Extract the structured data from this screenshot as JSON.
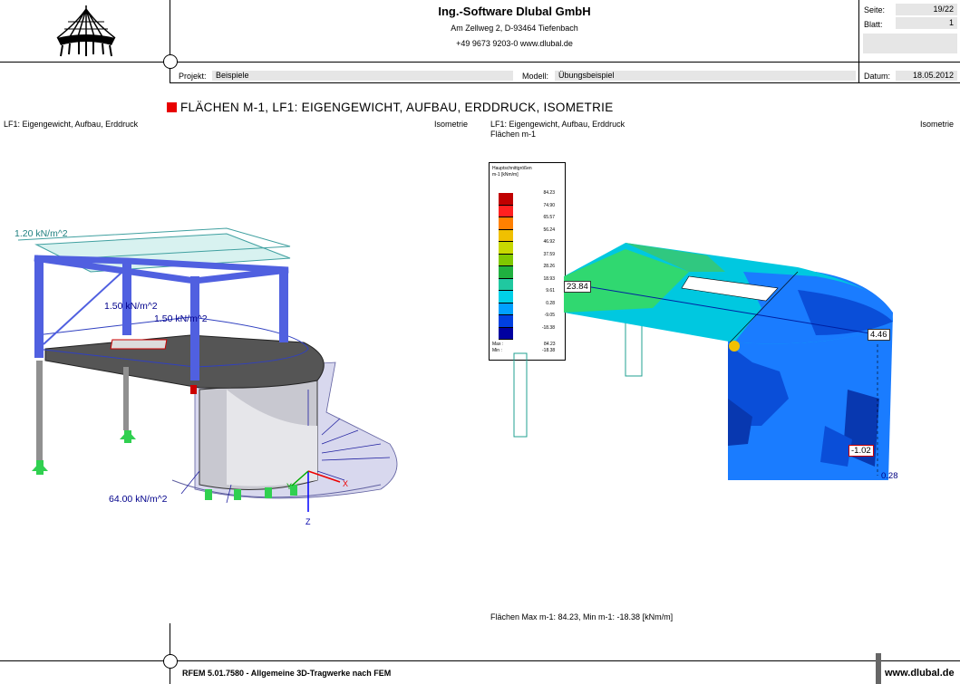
{
  "header": {
    "company": "Ing.-Software Dlubal GmbH",
    "address": "Am Zellweg 2, D-93464 Tiefenbach",
    "phone_web": "+49 9673 9203-0   www.dlubal.de",
    "seite_label": "Seite:",
    "seite_value": "19/22",
    "blatt_label": "Blatt:",
    "blatt_value": "1",
    "projekt_label": "Projekt:",
    "projekt_value": "Beispiele",
    "modell_label": "Modell:",
    "modell_value": "Übungsbeispiel",
    "datum_label": "Datum:",
    "datum_value": "18.05.2012"
  },
  "section_title": "FLÄCHEN M-1, LF1: EIGENGEWICHT, AUFBAU, ERDDRUCK, ISOMETRIE",
  "left_view": {
    "caption": "LF1: Eigengewicht, Aufbau, Erddruck",
    "view_label": "Isometrie",
    "load_1": "1.20 kN/m^2",
    "load_2": "1.50 kN/m^2",
    "load_3": "1.50 kN/m^2",
    "load_4": "64.00 kN/m^2",
    "axis_x": "X",
    "axis_y": "Y",
    "axis_z": "Z"
  },
  "right_view": {
    "caption": "LF1: Eigengewicht, Aufbau, Erddruck",
    "caption_2": "Flächen m-1",
    "view_label": "Isometrie",
    "value_a": "23.84",
    "value_b": "4.46",
    "value_c": "-1.02",
    "value_d": "0.28",
    "summary": "Flächen Max m-1: 84.23, Min m-1: -18.38 [kNm/m]"
  },
  "legend": {
    "title": "Hauptschnittgrößen",
    "subtitle": "m-1 [kNm/m]",
    "values": [
      "84.23",
      "74.90",
      "65.57",
      "56.24",
      "46.92",
      "37.59",
      "28.26",
      "18.93",
      "9.61",
      "0.28",
      "-9.05",
      "-18.38"
    ],
    "colors": [
      "#c00000",
      "#ff2020",
      "#ff8000",
      "#f0c000",
      "#c8d800",
      "#80c800",
      "#20b040",
      "#20c8a0",
      "#00d0e8",
      "#00a0ff",
      "#0040e0",
      "#0000a0"
    ],
    "max_label": "Max :",
    "max_value": "84.23",
    "min_label": "Min :",
    "min_value": "-18.38"
  },
  "footer": {
    "software": "RFEM 5.01.7580 - Allgemeine 3D-Tragwerke nach FEM",
    "website": "www.dlubal.de"
  }
}
